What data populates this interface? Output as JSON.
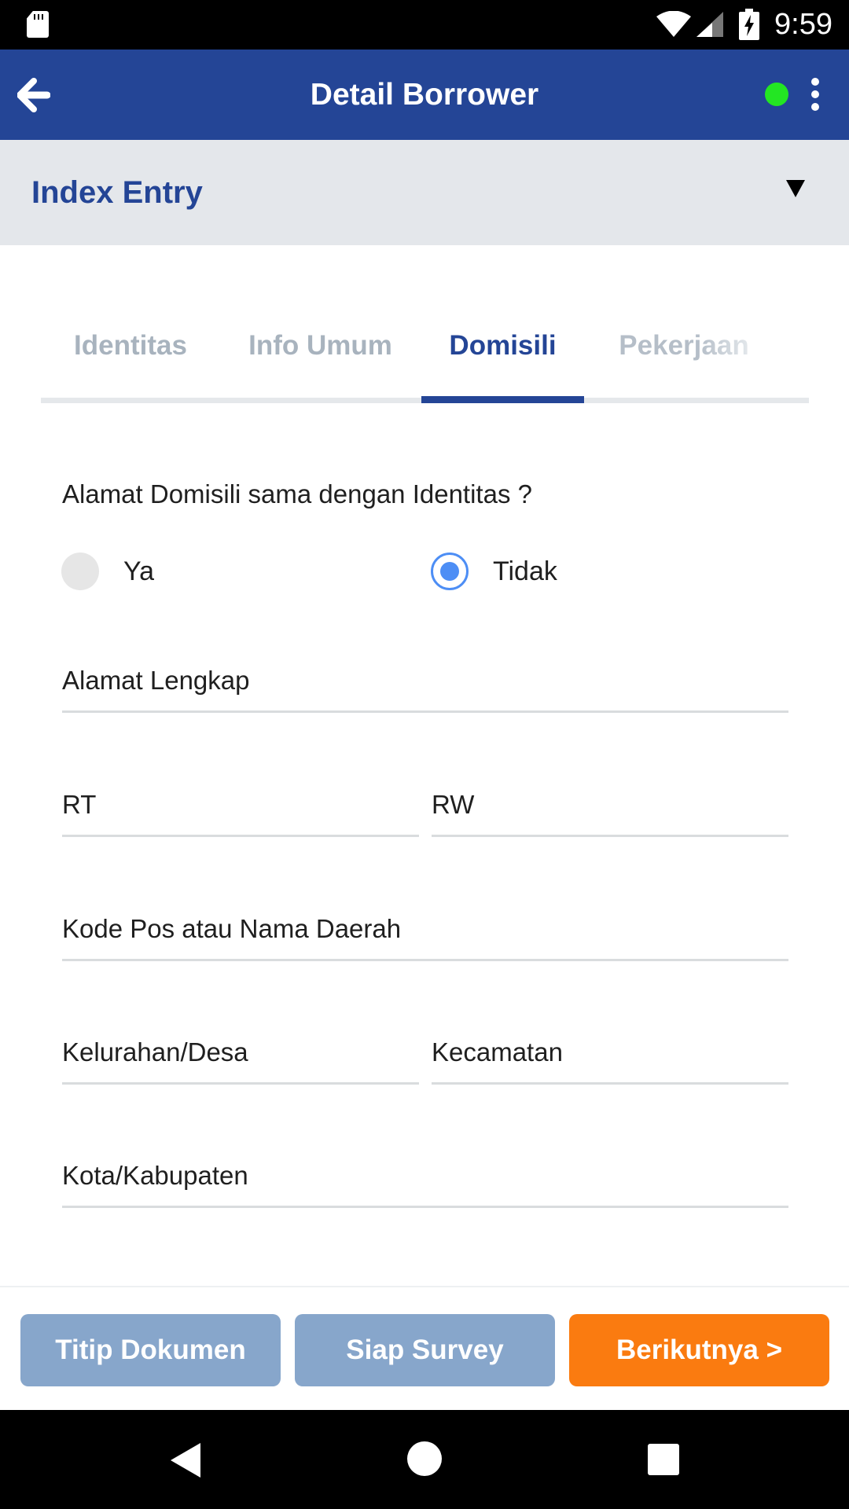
{
  "status_bar": {
    "time": "9:59",
    "icons": [
      "sd-card-icon",
      "wifi-icon",
      "cellular-icon",
      "battery-charging-icon"
    ]
  },
  "app_bar": {
    "title": "Detail Borrower",
    "back_icon": "arrow-left-icon",
    "status_indicator_color": "#23e623",
    "menu_icon": "more-vert-icon",
    "background": "#244596"
  },
  "section": {
    "title": "Index Entry",
    "toggle_icon": "triangle-down-icon"
  },
  "tabs": [
    {
      "label": "Identitas",
      "active": false
    },
    {
      "label": "Info Umum",
      "active": false
    },
    {
      "label": "Domisili",
      "active": true
    },
    {
      "label": "Pekerjaan",
      "active": false
    }
  ],
  "form": {
    "question": "Alamat Domisili sama dengan Identitas ?",
    "options": [
      {
        "label": "Ya",
        "selected": false
      },
      {
        "label": "Tidak",
        "selected": true
      }
    ],
    "fields": {
      "alamat_lengkap": "Alamat Lengkap",
      "rt": "RT",
      "rw": "RW",
      "kode_pos": "Kode Pos atau Nama Daerah",
      "kelurahan": "Kelurahan/Desa",
      "kecamatan": "Kecamatan",
      "kota": "Kota/Kabupaten"
    }
  },
  "actions": {
    "titip_dokumen": "Titip Dokumen",
    "siap_survey": "Siap Survey",
    "berikutnya": "Berikutnya >"
  },
  "colors": {
    "primary": "#244596",
    "accent": "#fa7b10",
    "muted_button": "#87a6cb",
    "radio_selected": "#4d8ef5"
  }
}
